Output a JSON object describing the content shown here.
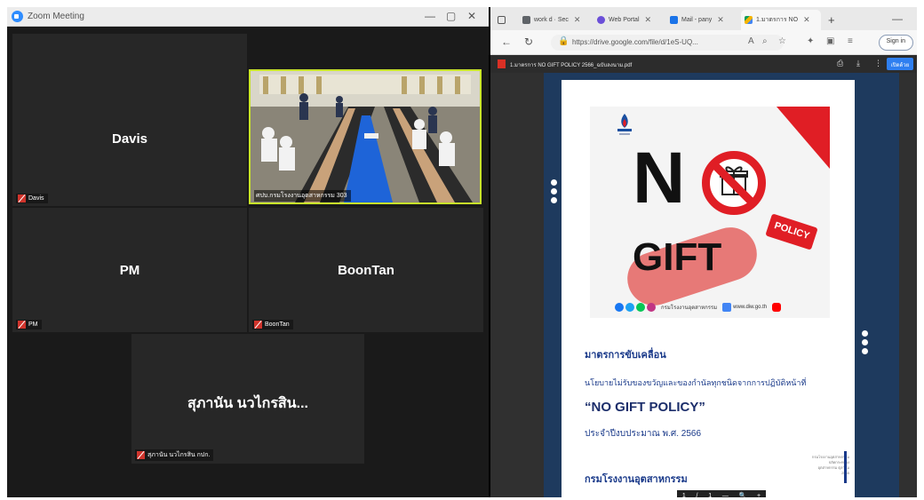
{
  "zoom": {
    "title": "Zoom Meeting",
    "controls": {
      "minimize": "—",
      "maximize": "▢",
      "close": "✕"
    },
    "participants": [
      {
        "name": "Davis",
        "tag": "Davis",
        "muted": true
      },
      {
        "name": "",
        "tag": "ศปบ.กรมโรงงานอุตสาหกรรม 303",
        "muted": false,
        "video": true,
        "active_speaker": true
      },
      {
        "name": "PM",
        "tag": "PM",
        "muted": true
      },
      {
        "name": "BoonTan",
        "tag": "BoonTan",
        "muted": true
      },
      {
        "name": "สุภานัน นวไกรสิน...",
        "tag": "สุภานัน นวไกรสิน กปก.",
        "muted": true
      }
    ]
  },
  "browser": {
    "tabs": [
      {
        "label": "work d · Sec",
        "icon_color": "#5f6368"
      },
      {
        "label": "Web Portal",
        "icon_color": "#6b4fd8"
      },
      {
        "label": "Mail - pany",
        "icon_color": "#1a73e8"
      },
      {
        "label": "1.มาตรการ NO",
        "icon_color": "#0f9d58",
        "active": true
      }
    ],
    "new_tab": "+",
    "url": "https://drive.google.com/file/d/1eS-UQ...",
    "sign_in": "Sign in",
    "pdf": {
      "filename": "1.มาตรการ NO GIFT POLICY 2566_ฉบับลงนาม.pdf",
      "open_label": "เปิดด้วย",
      "poster": {
        "big_letter": "N",
        "gift_word": "GIFT",
        "policy_tag": "POLICY",
        "social_text_1": "กรมโรงงานอุตสาหกรรม",
        "social_text_2": "www.diw.go.th"
      },
      "line1": "มาตรการขับเคลื่อน",
      "line2": "นโยบายไม่รับของขวัญและของกำนัลทุกชนิดจากการปฏิบัติหน้าที่",
      "line3": "“NO GIFT POLICY”",
      "line4": "ประจำปีงบประมาณ พ.ศ. 2566",
      "footer": "กรมโรงงานอุตสาหกรรม",
      "side_note": "กรมโรงงานอุตสาหกรรม ปลัดกระทรวงอุตสาหกรรม ตุลาคม 2565",
      "zoombar": [
        "1",
        "/",
        "1",
        "—",
        "🔍",
        "+"
      ]
    }
  }
}
